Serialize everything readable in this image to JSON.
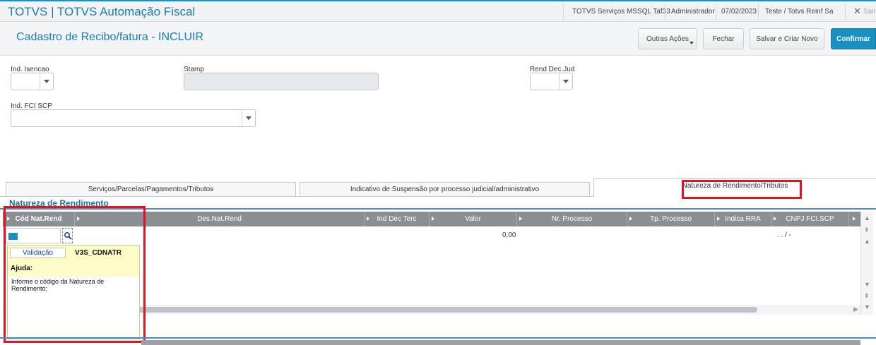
{
  "app": {
    "title": "TOTVS | TOTVS Automação Fiscal",
    "status": [
      "TOTVS Serviços MSSQL Taf33",
      "Administrador",
      "07/02/2023",
      "Teste / Totvs Reinf Sa"
    ],
    "exit_label": "Sair"
  },
  "page": {
    "title": "Cadastro de Recibo/fatura - INCLUIR",
    "buttons": {
      "outras": "Outras Ações",
      "fechar": "Fechar",
      "salvar": "Salvar e Criar Novo",
      "confirmar": "Confirmar"
    }
  },
  "form": {
    "ind_isencao_label": "Ind. Isencao",
    "stamp_label": "Stamp",
    "rend_dec_jud_label": "Rend Dec.Jud",
    "ind_fci_scp_label": "Ind. FCI SCP"
  },
  "tabs": [
    "Serviços/Parcelas/Pagamentos/Tributos",
    "Indicativo de Suspensão por processo judicial/administrativo",
    "Natureza de Rendimento/Tributos"
  ],
  "section_title": "Natureza de Rendimento",
  "grid": {
    "columns": [
      "Cód Nat.Rend",
      "Des.Nat.Rend",
      "Ind Dec Terc",
      "Valor",
      "Nr. Processo",
      "Tp. Processo",
      "Indica RRA",
      "CNPJ FCI.SCP"
    ],
    "row": {
      "valor": "0,00",
      "cnpj": ". . /  -"
    }
  },
  "help": {
    "tab_label": "Validação",
    "field_name": "V3S_CDNATR",
    "title": "Ajuda:",
    "text": "Informe o código da Natureza de Rendimento;"
  },
  "colors": {
    "accent": "#1a8fc2",
    "highlight": "#e4121c",
    "grid_header": "#8a8f94",
    "help_bg": "#fdfbc8"
  }
}
